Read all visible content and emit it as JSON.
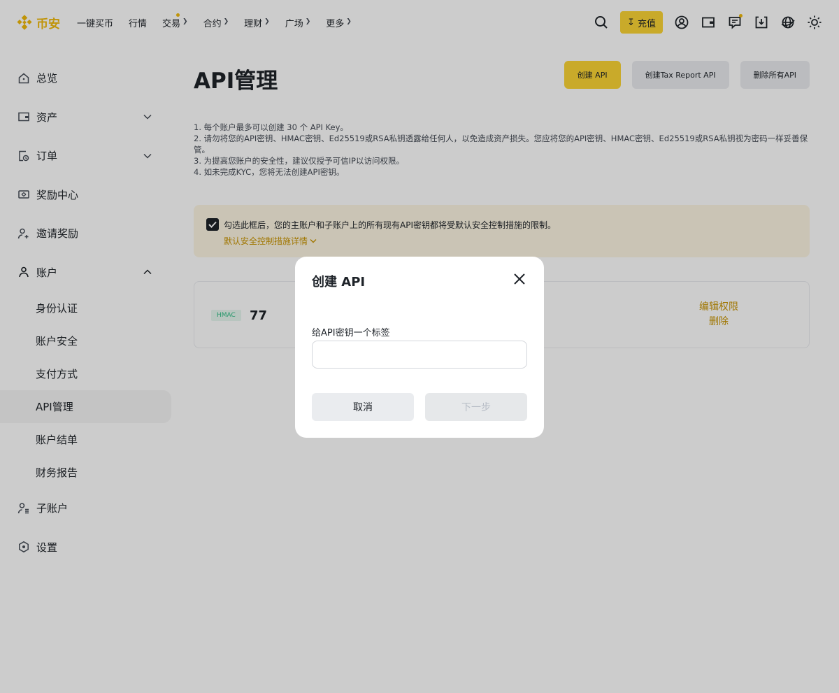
{
  "header": {
    "logo_text": "币安",
    "nav": [
      {
        "label": "一键买币",
        "dropdown": false
      },
      {
        "label": "行情",
        "dropdown": false
      },
      {
        "label": "交易",
        "dropdown": true,
        "dot": true
      },
      {
        "label": "合约",
        "dropdown": true
      },
      {
        "label": "理财",
        "dropdown": true
      },
      {
        "label": "广场",
        "dropdown": true
      },
      {
        "label": "更多",
        "dropdown": true
      }
    ],
    "deposit_label": "充值",
    "icons": [
      "search-icon",
      "deposit-icon",
      "user-icon",
      "wallet-icon",
      "message-icon",
      "download-icon",
      "globe-icon",
      "theme-icon"
    ]
  },
  "sidebar": {
    "items": [
      {
        "label": "总览",
        "icon": "home-icon"
      },
      {
        "label": "资产",
        "icon": "wallet-icon",
        "chevron": "down"
      },
      {
        "label": "订单",
        "icon": "order-icon",
        "chevron": "down"
      },
      {
        "label": "奖励中心",
        "icon": "reward-icon"
      },
      {
        "label": "邀请奖励",
        "icon": "invite-icon"
      },
      {
        "label": "账户",
        "icon": "account-icon",
        "chevron": "up"
      }
    ],
    "account_sub": [
      "身份认证",
      "账户安全",
      "支付方式",
      "API管理",
      "账户结单",
      "财务报告"
    ],
    "active_sub": "API管理",
    "bottom_items": [
      {
        "label": "子账户",
        "icon": "subaccount-icon"
      },
      {
        "label": "设置",
        "icon": "settings-icon"
      }
    ]
  },
  "main": {
    "title": "API管理",
    "buttons": {
      "create_api": "创建 API",
      "create_tax": "创建Tax Report API",
      "delete_all": "删除所有API"
    },
    "notes": [
      "1. 每个账户最多可以创建 30 个 API Key。",
      "2. 请勿将您的API密钥、HMAC密钥、Ed25519或RSA私钥透露给任何人，以免造成资产损失。您应将您的API密钥、HMAC密钥、Ed25519或RSA私钥视为密码一样妥善保管。",
      "3. 为提高您账户的安全性，建议仅授予可信IP以访问权限。",
      "4. 如未完成KYC，您将无法创建API密钥。"
    ],
    "notice": {
      "text": "勾选此框后，您的主账户和子账户上的所有现有API密钥都将受默认安全控制措施的限制。",
      "link": "默认安全控制措施详情",
      "checked": true
    },
    "key_card": {
      "badge": "HMAC",
      "name": "77",
      "edit_label": "编辑权限",
      "delete_label": "删除"
    }
  },
  "modal": {
    "title": "创建 API",
    "label": "给API密钥一个标签",
    "input_value": "",
    "input_placeholder": "",
    "cancel_label": "取消",
    "next_label": "下一步"
  },
  "colors": {
    "brand": "#f0b90b",
    "button_yellow": "#fcd535",
    "link_gold": "#c99400",
    "notice_bg": "#fdf6e3",
    "hmac_green": "#2ebd85"
  }
}
